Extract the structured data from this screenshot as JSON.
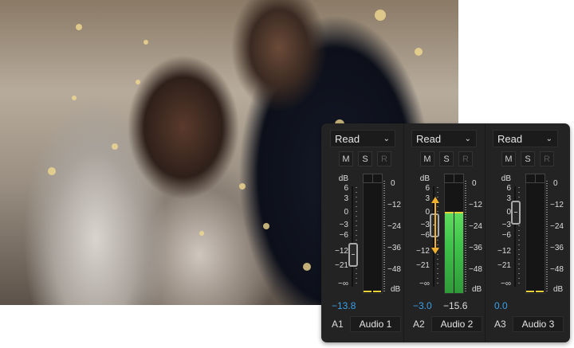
{
  "photo": {
    "description_icon": "wedding-photo"
  },
  "mixer": {
    "scale_unit": "dB",
    "fader_scale": [
      "6",
      "3",
      "0",
      "−3",
      "−6",
      "−12",
      "−21",
      "−∞"
    ],
    "meter_scale": [
      "0",
      "−12",
      "−24",
      "−36",
      "−48",
      "dB"
    ],
    "buttons": {
      "mute": "M",
      "solo": "S",
      "record": "R"
    },
    "channels": [
      {
        "id": "A1",
        "name": "Audio 1",
        "mode": "Read",
        "volume": "−13.8",
        "volume_db": -13.8,
        "meter_db": null,
        "meter_readout": ""
      },
      {
        "id": "A2",
        "name": "Audio 2",
        "mode": "Read",
        "volume": "−3.0",
        "volume_db": -3.0,
        "meter_db": -15.6,
        "meter_readout": "−15.6",
        "adjust_arrow": true
      },
      {
        "id": "A3",
        "name": "Audio 3",
        "mode": "Read",
        "volume": "0.0",
        "volume_db": 0,
        "meter_db": null,
        "meter_readout": ""
      }
    ],
    "colors": {
      "value": "#3aa0e8",
      "meter": "#3fc24a",
      "peak": "#e8d23a",
      "arrow": "#f0b030",
      "panel": "#232323"
    }
  }
}
